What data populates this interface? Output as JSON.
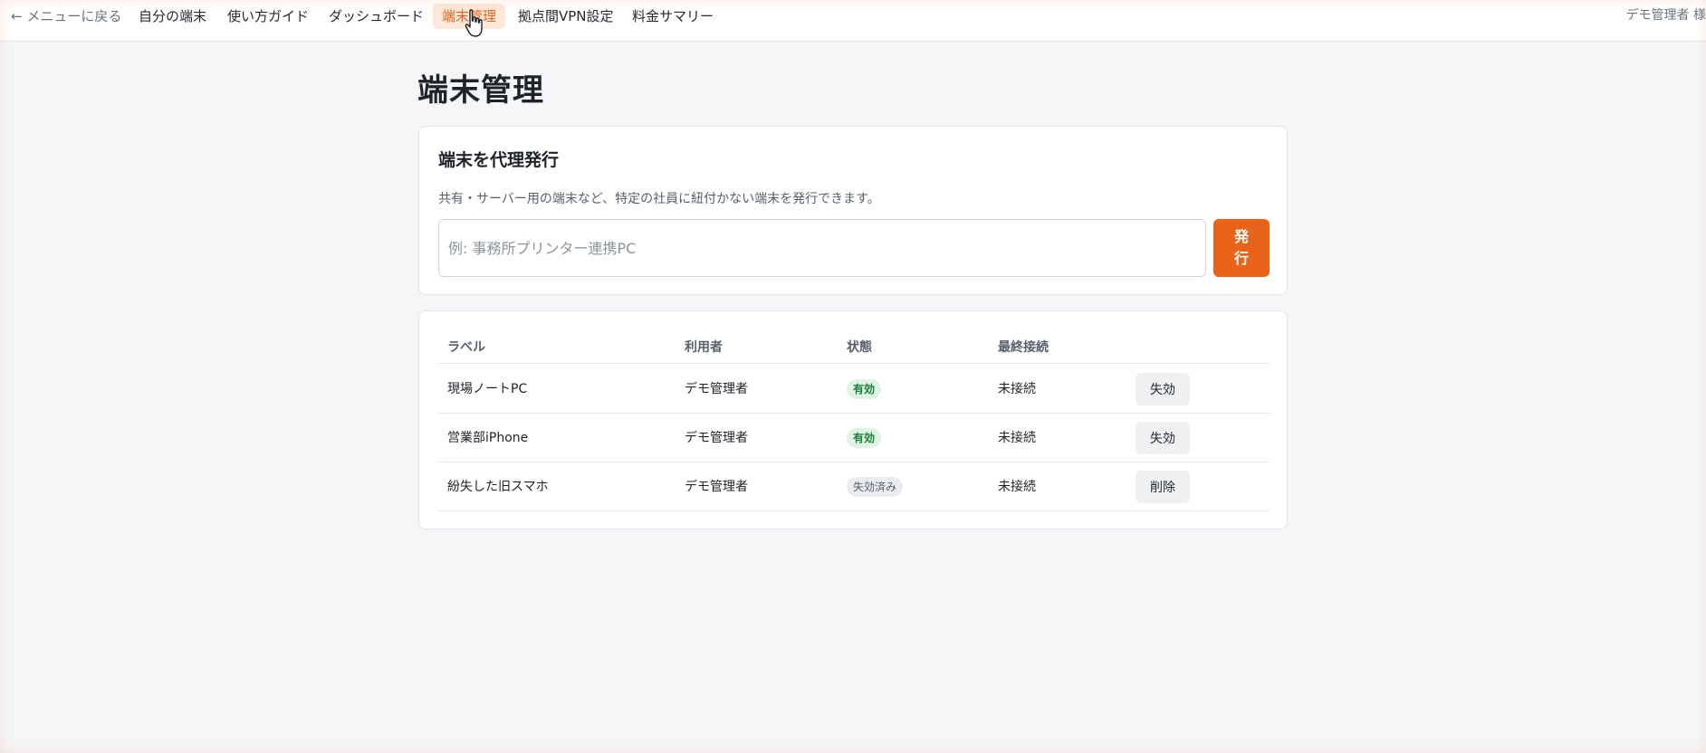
{
  "nav": {
    "back": "← メニューに戻る",
    "items": [
      {
        "label": "自分の端末"
      },
      {
        "label": "使い方ガイド"
      },
      {
        "label": "ダッシュボード"
      },
      {
        "label": "端末管理"
      },
      {
        "label": "拠点間VPN設定"
      },
      {
        "label": "料金サマリー"
      }
    ],
    "active_index": 3,
    "user": "デモ管理者 様"
  },
  "page": {
    "title": "端末管理"
  },
  "issue_card": {
    "heading": "端末を代理発行",
    "description": "共有・サーバー用の端末など、特定の社員に紐付かない端末を発行できます。",
    "input_placeholder": "例: 事務所プリンター連携PC",
    "input_value": "",
    "button_label": "発行"
  },
  "devices": {
    "columns": [
      "ラベル",
      "利用者",
      "状態",
      "最終接続"
    ],
    "rows": [
      {
        "label": "現場ノートPC",
        "user": "デモ管理者",
        "status": "有効",
        "status_kind": "active",
        "last_connected": "未接続",
        "action": "失効"
      },
      {
        "label": "営業部iPhone",
        "user": "デモ管理者",
        "status": "有効",
        "status_kind": "active",
        "last_connected": "未接続",
        "action": "失効"
      },
      {
        "label": "紛失した旧スマホ",
        "user": "デモ管理者",
        "status": "失効済み",
        "status_kind": "revoked",
        "last_connected": "未接続",
        "action": "削除"
      }
    ]
  },
  "colors": {
    "accent": "#e8641b",
    "active_badge_bg": "#dff3e4",
    "active_badge_text": "#1a7f37",
    "page_bg": "#f5f6f8"
  },
  "icons": {
    "cursor": "pointer-cursor-icon"
  }
}
